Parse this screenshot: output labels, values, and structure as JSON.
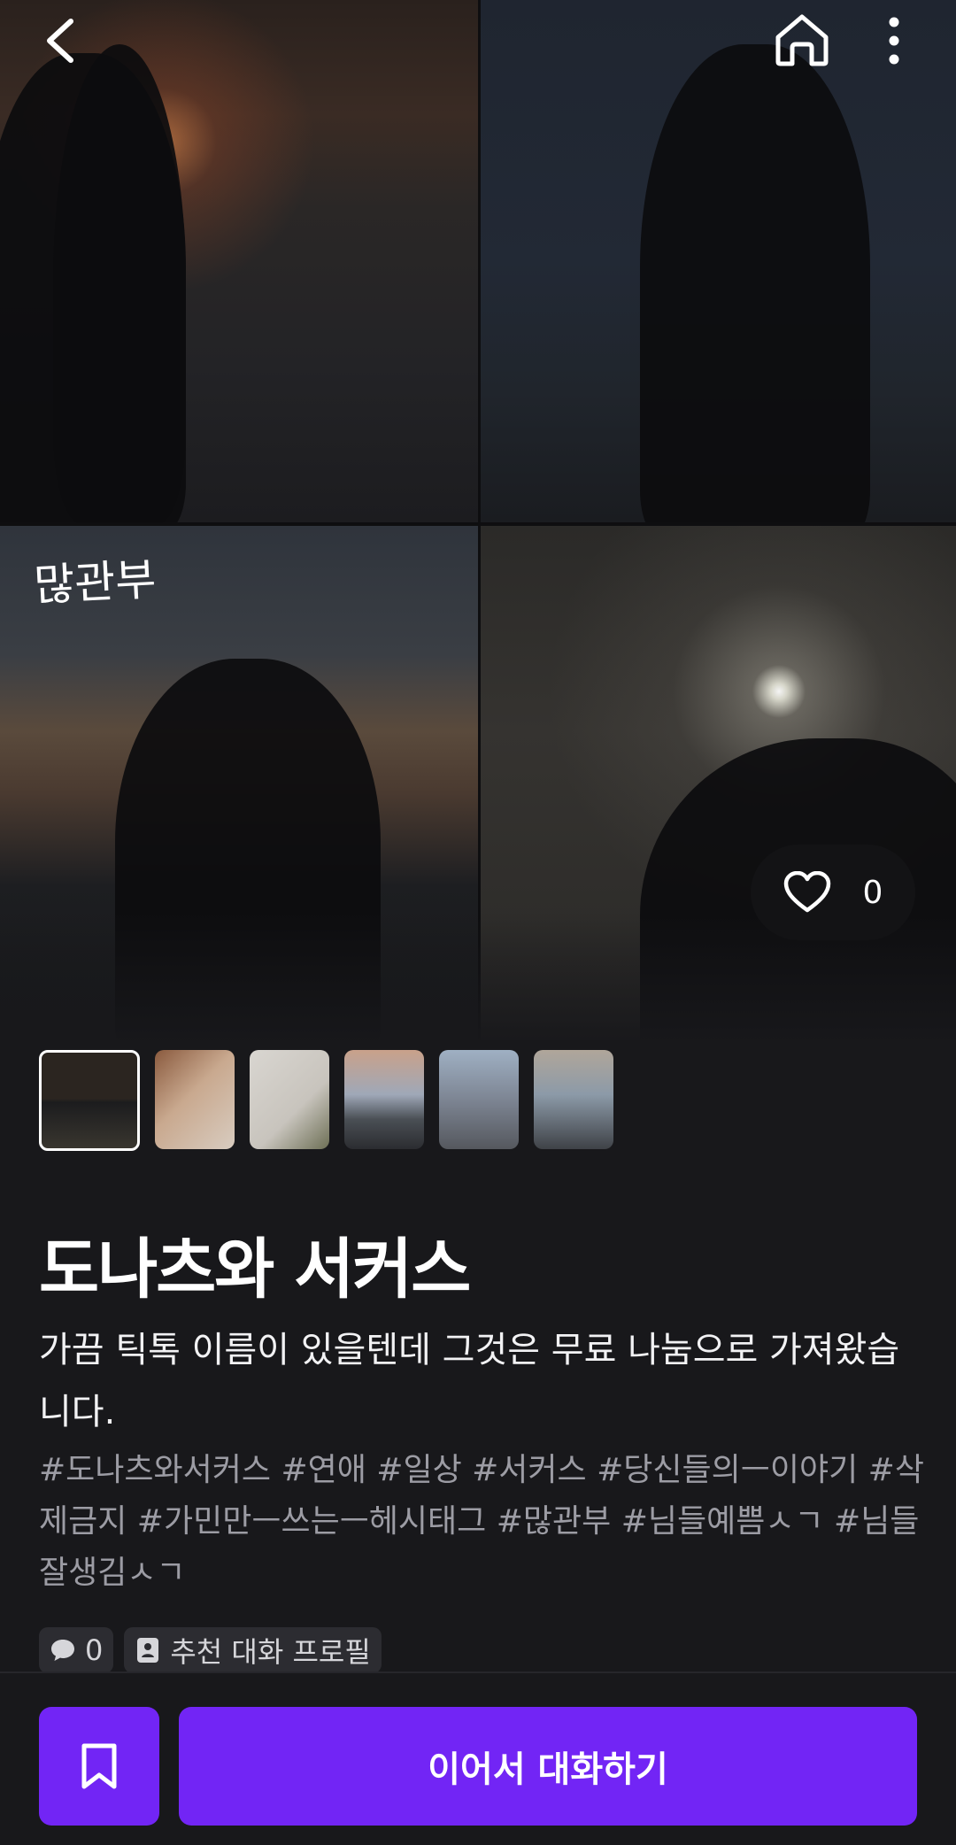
{
  "hero": {
    "overlay_text": "많관부",
    "like_count": "0"
  },
  "icons": {
    "back": "chevron-left-icon",
    "home": "home-icon",
    "more": "more-vertical-icon",
    "like": "heart-outline-icon",
    "comment": "speech-bubble-icon",
    "profile": "profile-card-icon",
    "bookmark": "bookmark-icon"
  },
  "gallery": {
    "thumbnail_count": 6,
    "active_index": 0
  },
  "character": {
    "title": "도나츠와 서커스",
    "description": "가끔 틱톡 이름이 있을텐데 그것은 무료 나눔으로 가져왔습니다.",
    "tags": "#도나츠와서커스 #연애 #일상 #서커스 #당신들의ㅡ이야기 #삭제금지 #가민만ㅡ쓰는ㅡ헤시태그 #많관부 #님들예쁨ㅅㄱ #님들잘생김ㅅㄱ"
  },
  "chips": {
    "comment_count": "0",
    "profile_label": "추천 대화 프로필"
  },
  "actions": {
    "continue_label": "이어서 대화하기"
  },
  "colors": {
    "background": "#18181b",
    "accent": "#7225f5",
    "tag_text": "#9c9ca4",
    "chip_bg": "#2c2c31"
  }
}
